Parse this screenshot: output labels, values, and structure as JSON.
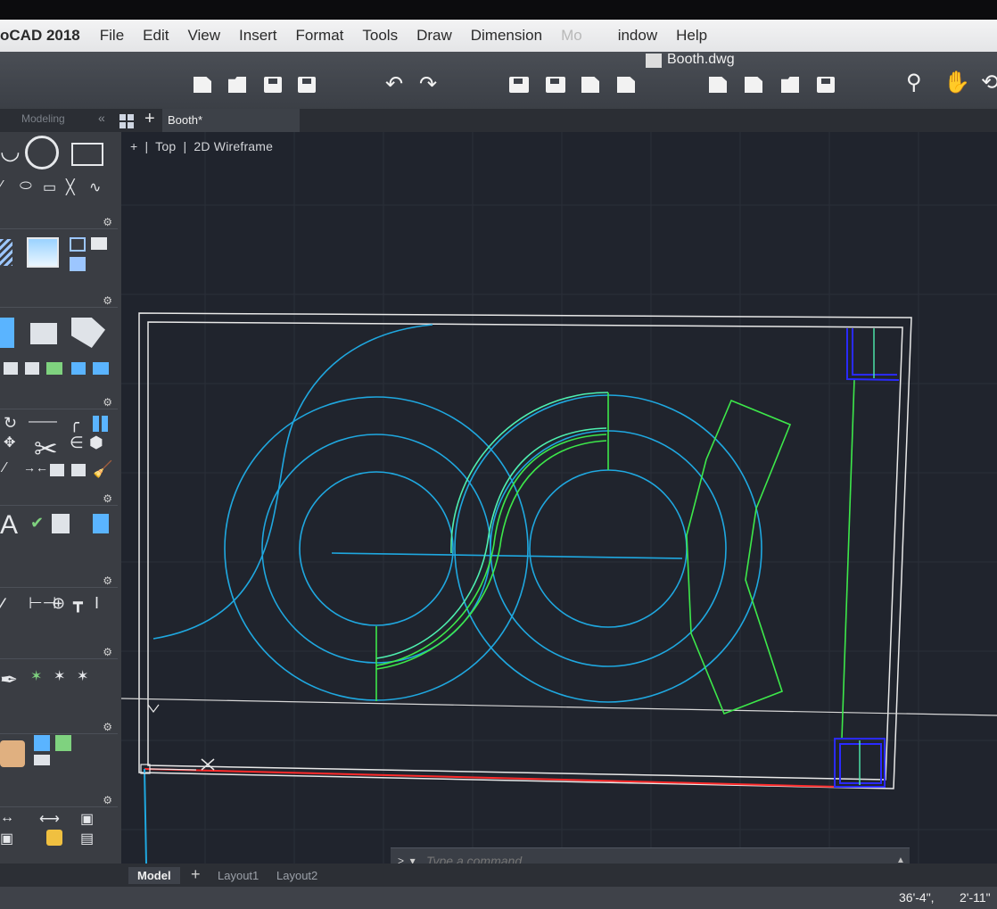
{
  "menubar": {
    "app_title": "oCAD 2018",
    "items": [
      "File",
      "Edit",
      "View",
      "Insert",
      "Format",
      "Tools",
      "Draw",
      "Dimension",
      "Mo",
      "indow",
      "Help"
    ],
    "document_title": "Booth.dwg"
  },
  "tabs": {
    "palette_label": "Modeling",
    "document_tab": "Booth*"
  },
  "viewport": {
    "view": "Top",
    "visual_style": "2D Wireframe"
  },
  "command": {
    "prompt": ">_▾",
    "placeholder": "Type a command"
  },
  "layouts": {
    "model": "Model",
    "layout1": "Layout1",
    "layout2": "Layout2"
  },
  "status": {
    "x_coord": "36'-4\",",
    "y_coord": "2'-11\""
  },
  "colors": {
    "border_white": "#e8e8e8",
    "cyan": "#1fa8e0",
    "green": "#3de84a",
    "mint": "#4ef0b0",
    "red": "#ff2a2a",
    "blue": "#2a2aff"
  }
}
